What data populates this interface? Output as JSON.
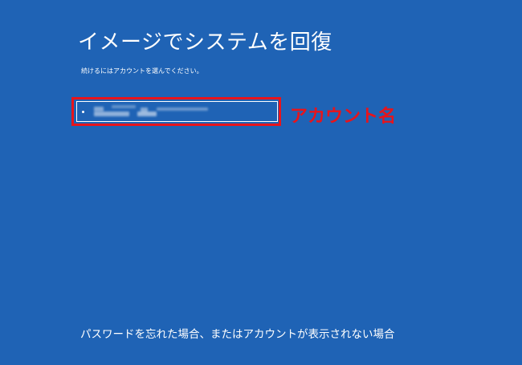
{
  "screen": {
    "title": "イメージでシステムを回復",
    "instruction": "続けるにはアカウントを選んでください。",
    "account_name_label": "アカウント名",
    "forgot_link": "パスワードを忘れた場合、またはアカウントが表示されない場合"
  },
  "colors": {
    "background": "#1f63b5",
    "highlight": "#e8141b",
    "text": "#ffffff"
  }
}
